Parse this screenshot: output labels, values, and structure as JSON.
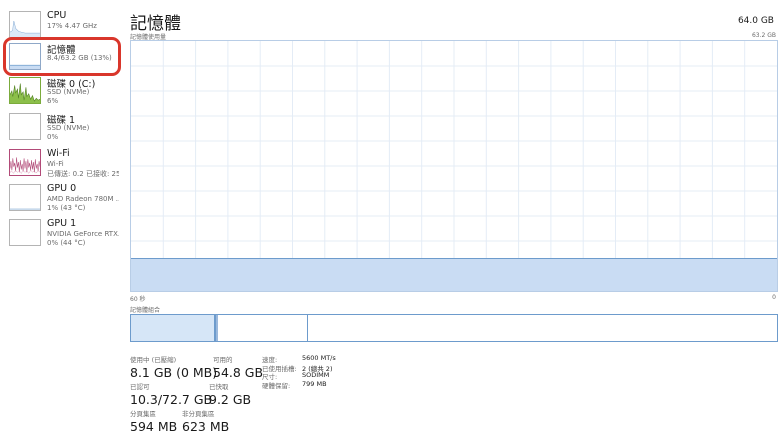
{
  "colors": {
    "accent_blue": "#6d9bcc",
    "graph_fill": "#c9dcf3",
    "highlight": "#d9362b",
    "disk_green": "#7bab3c",
    "wifi_pink": "#b24a78"
  },
  "sidebar": {
    "items": [
      {
        "title": "CPU",
        "sub1": "17%  4.47 GHz",
        "sub2": ""
      },
      {
        "title": "記憶體",
        "sub1": "8.4/63.2 GB (13%)",
        "sub2": ""
      },
      {
        "title": "磁碟 0 (C:)",
        "sub1": "SSD (NVMe)",
        "sub2": "6%"
      },
      {
        "title": "磁碟 1",
        "sub1": "SSD (NVMe)",
        "sub2": "0%"
      },
      {
        "title": "Wi-Fi",
        "sub1": "Wi-Fi",
        "sub2": "已傳送: 0.2  已接收: 25.4"
      },
      {
        "title": "GPU 0",
        "sub1": "AMD Radeon 780M ...",
        "sub2": "1% (43 °C)"
      },
      {
        "title": "GPU 1",
        "sub1": "NVIDIA GeForce RTX...",
        "sub2": "0% (44 °C)"
      }
    ]
  },
  "main": {
    "title": "記憶體",
    "total": "64.0 GB",
    "graph_caption": "記憶體使用量",
    "graph_max": "63.2 GB",
    "graph_usage_fraction": 0.13,
    "axis_left": "60 秒",
    "axis_right": "0",
    "composition_caption": "記憶體組合"
  },
  "stats": {
    "in_use_label": "使用中 (已壓縮)",
    "in_use_value": "8.1 GB (0 MB)",
    "available_label": "可用的",
    "available_value": "54.8 GB",
    "committed_label": "已認可",
    "committed_value": "10.3/72.7 GB",
    "cached_label": "已快取",
    "cached_value": "9.2 GB",
    "paged_label": "分頁集區",
    "paged_value": "594 MB",
    "nonpaged_label": "非分頁集區",
    "nonpaged_value": "623 MB"
  },
  "specs": [
    {
      "key": "速度:",
      "value": "5600 MT/s"
    },
    {
      "key": "已使用插槽:",
      "value": "2 (總共 2)"
    },
    {
      "key": "尺寸:",
      "value": "SODIMM"
    },
    {
      "key": "硬體保留:",
      "value": "799 MB"
    }
  ]
}
